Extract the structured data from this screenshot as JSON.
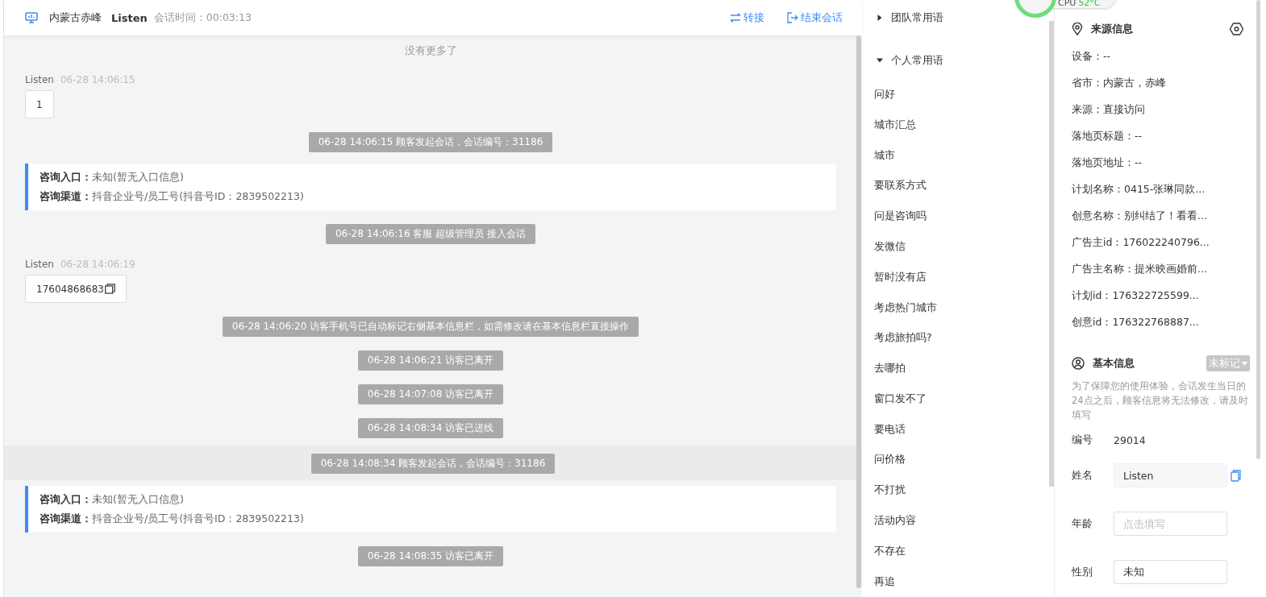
{
  "header": {
    "location": "内蒙古赤峰",
    "visitor": "Listen",
    "duration_label": "会话时间：",
    "duration": "00:03:13",
    "actions": [
      {
        "kind": "transfer",
        "label": "转接"
      },
      {
        "kind": "end",
        "label": "结束会话"
      }
    ]
  },
  "chat": [
    {
      "kind": "notice",
      "text": "没有更多了"
    },
    {
      "kind": "customer",
      "name": "Listen",
      "time": "06-28 14:06:15",
      "text": "1",
      "copyable": false
    },
    {
      "kind": "system",
      "text": "06-28 14:06:15 顾客发起会话，会话编号：31186",
      "highlighted": false
    },
    {
      "kind": "info",
      "lines": [
        {
          "label": "咨询入口：",
          "value": "未知(暂无入口信息)"
        },
        {
          "label": "咨询渠道：",
          "value": "抖音企业号/员工号(抖音号ID：2839502213)"
        }
      ]
    },
    {
      "kind": "system",
      "text": "06-28 14:06:16 客服 超级管理员 接入会话",
      "highlighted": false
    },
    {
      "kind": "customer",
      "name": "Listen",
      "time": "06-28 14:06:19",
      "text": "17604868683",
      "copyable": true
    },
    {
      "kind": "system",
      "text": "06-28 14:06:20 访客手机号已自动标记右侧基本信息栏，如需修改请在基本信息栏直接操作",
      "highlighted": false
    },
    {
      "kind": "system",
      "text": "06-28 14:06:21 访客已离开",
      "highlighted": false
    },
    {
      "kind": "system",
      "text": "06-28 14:07:08 访客已离开",
      "highlighted": false
    },
    {
      "kind": "system",
      "text": "06-28 14:08:34 访客已进线",
      "highlighted": false
    },
    {
      "kind": "system",
      "text": "06-28 14:08:34 顾客发起会话，会话编号：31186",
      "highlighted": true
    },
    {
      "kind": "info",
      "lines": [
        {
          "label": "咨询入口：",
          "value": "未知(暂无入口信息)"
        },
        {
          "label": "咨询渠道：",
          "value": "抖音企业号/员工号(抖音号ID：2839502213)"
        }
      ]
    },
    {
      "kind": "system",
      "text": "06-28 14:08:35 访客已离开",
      "highlighted": false
    }
  ],
  "phrases": [
    {
      "label": "团队常用语",
      "expanded": false
    },
    {
      "label": "个人常用语",
      "expanded": true,
      "children": [
        "问好",
        "城市汇总",
        "城市",
        "要联系方式",
        "问是咨询吗",
        "发微信",
        "暂时没有店",
        "考虑热门城市",
        "考虑旅拍吗?",
        "去哪拍",
        "窗口发不了",
        "要电话",
        "问价格",
        "不打扰",
        "活动内容",
        "不存在",
        "再追"
      ]
    }
  ],
  "cpu_widget": {
    "label": "CPU",
    "temperature": "52°C"
  },
  "source_info": {
    "title": "来源信息",
    "rows": [
      "设备：--",
      "省市：内蒙古，赤峰",
      "来源：直接访问",
      "落地页标题：--",
      "落地页地址：--",
      "计划名称：0415-张琳同款...",
      "创意名称：别纠结了！看看...",
      "广告主id：176022240796...",
      "广告主名称：提米映画婚前...",
      "计划id：176322725599...",
      "创意id：176322768887..."
    ]
  },
  "basic_info": {
    "title": "基本信息",
    "tag": "未标记",
    "note": "为了保障您的使用体验，会话发生当日的24点之后，顾客信息将无法修改，请及时填写",
    "fields": [
      {
        "kind": "text",
        "label": "编号",
        "value": "29014"
      },
      {
        "kind": "input",
        "label": "姓名",
        "value": "Listen",
        "filled": true,
        "copyable": true
      },
      {
        "kind": "input",
        "label": "年龄",
        "placeholder": "点击填写",
        "filled": false,
        "copyable": false
      },
      {
        "kind": "input",
        "label": "性别",
        "value": "未知",
        "filled": false,
        "copyable": false
      }
    ]
  }
}
